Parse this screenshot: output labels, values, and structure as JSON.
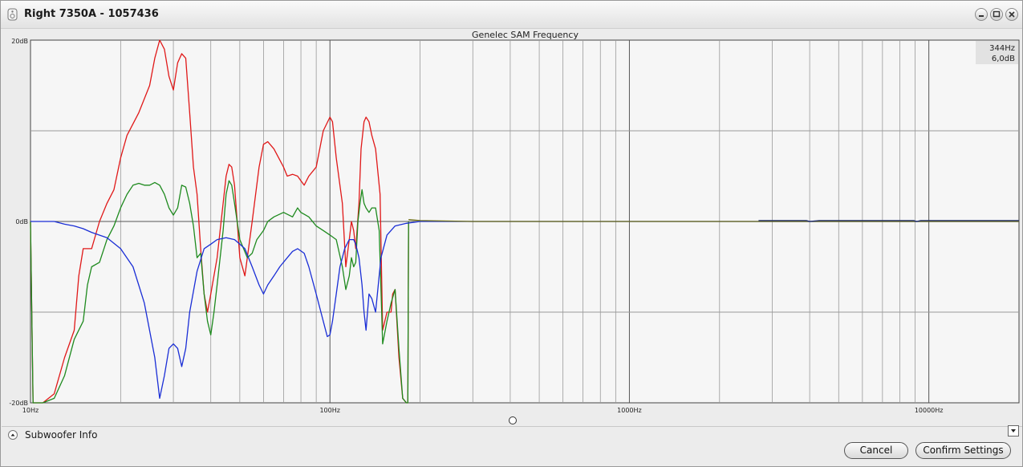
{
  "window": {
    "title": "Right 7350A - 1057436",
    "controls": [
      "minimize-icon",
      "maximize-icon",
      "close-icon"
    ]
  },
  "chart_data": {
    "type": "line",
    "title": "Genelec SAM Frequency",
    "x_scale": "log",
    "xlim": [
      10,
      20000
    ],
    "ylim": [
      -20,
      20
    ],
    "x_tick_labels": [
      {
        "x": 10,
        "label": "10Hz"
      },
      {
        "x": 100,
        "label": "100Hz"
      },
      {
        "x": 1000,
        "label": "1000Hz"
      },
      {
        "x": 10000,
        "label": "10000Hz"
      }
    ],
    "y_tick_labels": [
      {
        "y": 20,
        "label": "20dB"
      },
      {
        "y": 0,
        "label": "0dB"
      },
      {
        "y": -20,
        "label": "-20dB"
      }
    ],
    "grid": true,
    "cursor_readout": {
      "freq": "344Hz",
      "level": "6,0dB"
    },
    "colors": {
      "red": "#e01818",
      "green": "#1e8a1e",
      "blue": "#1a2ed6",
      "olive": "#6b6b10",
      "navy": "#1c2a6e"
    },
    "series": [
      {
        "color": "red",
        "points": [
          [
            10,
            0
          ],
          [
            10.2,
            -20
          ],
          [
            11,
            -20
          ],
          [
            12,
            -19
          ],
          [
            13,
            -15
          ],
          [
            14,
            -12
          ],
          [
            14.5,
            -6
          ],
          [
            15,
            -3
          ],
          [
            16,
            -3
          ],
          [
            17,
            0
          ],
          [
            18,
            2
          ],
          [
            19,
            3.5
          ],
          [
            20,
            7
          ],
          [
            21,
            9.5
          ],
          [
            23,
            12
          ],
          [
            25,
            15
          ],
          [
            26,
            18
          ],
          [
            27,
            20
          ],
          [
            28,
            19
          ],
          [
            29,
            16
          ],
          [
            30,
            14.5
          ],
          [
            31,
            17.5
          ],
          [
            32,
            18.5
          ],
          [
            33,
            18
          ],
          [
            34,
            12
          ],
          [
            35,
            6
          ],
          [
            36,
            3
          ],
          [
            37,
            -3
          ],
          [
            38,
            -8
          ],
          [
            39,
            -10
          ],
          [
            40,
            -8
          ],
          [
            42,
            -4
          ],
          [
            44,
            2
          ],
          [
            45,
            5
          ],
          [
            46,
            6.3
          ],
          [
            47,
            6
          ],
          [
            48,
            4
          ],
          [
            50,
            -4
          ],
          [
            52,
            -6
          ],
          [
            55,
            0
          ],
          [
            58,
            6
          ],
          [
            60,
            8.5
          ],
          [
            62,
            8.8
          ],
          [
            65,
            8
          ],
          [
            70,
            6
          ],
          [
            72,
            5
          ],
          [
            75,
            5.2
          ],
          [
            78,
            5
          ],
          [
            80,
            4.5
          ],
          [
            82,
            4
          ],
          [
            85,
            5
          ],
          [
            90,
            6
          ],
          [
            95,
            10
          ],
          [
            100,
            11.5
          ],
          [
            102,
            11
          ],
          [
            105,
            7
          ],
          [
            110,
            2
          ],
          [
            113,
            -5
          ],
          [
            116,
            -2
          ],
          [
            118,
            0
          ],
          [
            120,
            -1
          ],
          [
            122,
            -3
          ],
          [
            125,
            2
          ],
          [
            127,
            8
          ],
          [
            130,
            11
          ],
          [
            132,
            11.5
          ],
          [
            135,
            11
          ],
          [
            138,
            9.5
          ],
          [
            142,
            8
          ],
          [
            147,
            3
          ],
          [
            150,
            -12
          ],
          [
            155,
            -10
          ],
          [
            160,
            -10
          ],
          [
            162,
            -8
          ],
          [
            165,
            -7.5
          ],
          [
            170,
            -15
          ],
          [
            175,
            -19.5
          ],
          [
            180,
            -20
          ],
          [
            182,
            -20
          ],
          [
            183,
            0
          ]
        ]
      },
      {
        "color": "green",
        "points": [
          [
            10,
            0
          ],
          [
            10.2,
            -20
          ],
          [
            11,
            -20
          ],
          [
            12,
            -19.5
          ],
          [
            13,
            -17
          ],
          [
            14,
            -13
          ],
          [
            15,
            -11
          ],
          [
            15.5,
            -7
          ],
          [
            16,
            -5
          ],
          [
            17,
            -4.5
          ],
          [
            18,
            -2
          ],
          [
            19,
            -0.5
          ],
          [
            20,
            1.5
          ],
          [
            21,
            3
          ],
          [
            22,
            4
          ],
          [
            23,
            4.2
          ],
          [
            24,
            4
          ],
          [
            25,
            4
          ],
          [
            26,
            4.3
          ],
          [
            27,
            4
          ],
          [
            28,
            3
          ],
          [
            29,
            1.5
          ],
          [
            30,
            0.7
          ],
          [
            31,
            1.5
          ],
          [
            32,
            4
          ],
          [
            33,
            3.8
          ],
          [
            34,
            2
          ],
          [
            35,
            -0.5
          ],
          [
            36,
            -4
          ],
          [
            37,
            -3.5
          ],
          [
            38,
            -8
          ],
          [
            39,
            -11
          ],
          [
            40,
            -12.5
          ],
          [
            41,
            -10
          ],
          [
            42,
            -7
          ],
          [
            44,
            -1
          ],
          [
            45,
            3
          ],
          [
            46,
            4.5
          ],
          [
            47,
            4
          ],
          [
            48,
            2
          ],
          [
            50,
            -2
          ],
          [
            53,
            -4
          ],
          [
            55,
            -3.5
          ],
          [
            57,
            -2
          ],
          [
            60,
            -1
          ],
          [
            62,
            0
          ],
          [
            65,
            0.5
          ],
          [
            70,
            1
          ],
          [
            75,
            0.5
          ],
          [
            78,
            1.5
          ],
          [
            80,
            1
          ],
          [
            85,
            0.5
          ],
          [
            90,
            -0.5
          ],
          [
            95,
            -1
          ],
          [
            100,
            -1.5
          ],
          [
            105,
            -2
          ],
          [
            110,
            -5
          ],
          [
            113,
            -7.5
          ],
          [
            116,
            -6
          ],
          [
            118,
            -4
          ],
          [
            120,
            -5
          ],
          [
            122,
            -4.5
          ],
          [
            124,
            0
          ],
          [
            126,
            2
          ],
          [
            128,
            3.5
          ],
          [
            130,
            2
          ],
          [
            132,
            1.5
          ],
          [
            135,
            1
          ],
          [
            138,
            1.5
          ],
          [
            142,
            1.5
          ],
          [
            146,
            -1
          ],
          [
            150,
            -13.5
          ],
          [
            155,
            -11
          ],
          [
            160,
            -9
          ],
          [
            165,
            -7.5
          ],
          [
            170,
            -14
          ],
          [
            175,
            -19.5
          ],
          [
            180,
            -20
          ],
          [
            182,
            -20
          ],
          [
            183,
            0
          ]
        ]
      },
      {
        "color": "blue",
        "points": [
          [
            10,
            0
          ],
          [
            12,
            0
          ],
          [
            13,
            -0.3
          ],
          [
            14,
            -0.5
          ],
          [
            15,
            -0.8
          ],
          [
            16,
            -1.2
          ],
          [
            18,
            -1.8
          ],
          [
            20,
            -3
          ],
          [
            22,
            -5
          ],
          [
            24,
            -9
          ],
          [
            26,
            -15
          ],
          [
            27,
            -19.5
          ],
          [
            28,
            -17
          ],
          [
            29,
            -14
          ],
          [
            30,
            -13.5
          ],
          [
            31,
            -14
          ],
          [
            32,
            -16
          ],
          [
            33,
            -14
          ],
          [
            34,
            -10
          ],
          [
            36,
            -5.5
          ],
          [
            38,
            -3
          ],
          [
            40,
            -2.5
          ],
          [
            42,
            -2
          ],
          [
            45,
            -1.8
          ],
          [
            48,
            -2
          ],
          [
            50,
            -2.5
          ],
          [
            52,
            -3
          ],
          [
            55,
            -5
          ],
          [
            58,
            -7
          ],
          [
            60,
            -8
          ],
          [
            62,
            -7
          ],
          [
            65,
            -6
          ],
          [
            68,
            -5
          ],
          [
            72,
            -4
          ],
          [
            75,
            -3.3
          ],
          [
            78,
            -3
          ],
          [
            82,
            -3.5
          ],
          [
            85,
            -5
          ],
          [
            90,
            -8
          ],
          [
            95,
            -11
          ],
          [
            98,
            -12.7
          ],
          [
            100,
            -12.5
          ],
          [
            102,
            -11
          ],
          [
            105,
            -8
          ],
          [
            108,
            -5
          ],
          [
            112,
            -3
          ],
          [
            116,
            -2
          ],
          [
            120,
            -2
          ],
          [
            122,
            -2.5
          ],
          [
            125,
            -4
          ],
          [
            128,
            -7
          ],
          [
            130,
            -10
          ],
          [
            132,
            -12
          ],
          [
            135,
            -8
          ],
          [
            138,
            -8.5
          ],
          [
            142,
            -10
          ],
          [
            148,
            -4
          ],
          [
            155,
            -1.5
          ],
          [
            165,
            -0.5
          ],
          [
            180,
            -0.2
          ],
          [
            200,
            0
          ],
          [
            300,
            0
          ],
          [
            1000,
            0
          ],
          [
            20000,
            0
          ]
        ]
      },
      {
        "color": "olive",
        "points": [
          [
            183,
            0.2
          ],
          [
            200,
            0.1
          ],
          [
            300,
            0
          ],
          [
            1000,
            0
          ],
          [
            20000,
            0
          ]
        ]
      },
      {
        "color": "navy",
        "points": [
          [
            2700,
            0.1
          ],
          [
            3900,
            0.1
          ],
          [
            4000,
            0
          ],
          [
            4300,
            0.1
          ],
          [
            8900,
            0.1
          ],
          [
            9100,
            0
          ],
          [
            9400,
            0.1
          ],
          [
            20000,
            0.1
          ]
        ]
      }
    ]
  },
  "subwoofer": {
    "label": "Subwoofer Info"
  },
  "buttons": {
    "cancel": "Cancel",
    "confirm": "Confirm Settings"
  }
}
